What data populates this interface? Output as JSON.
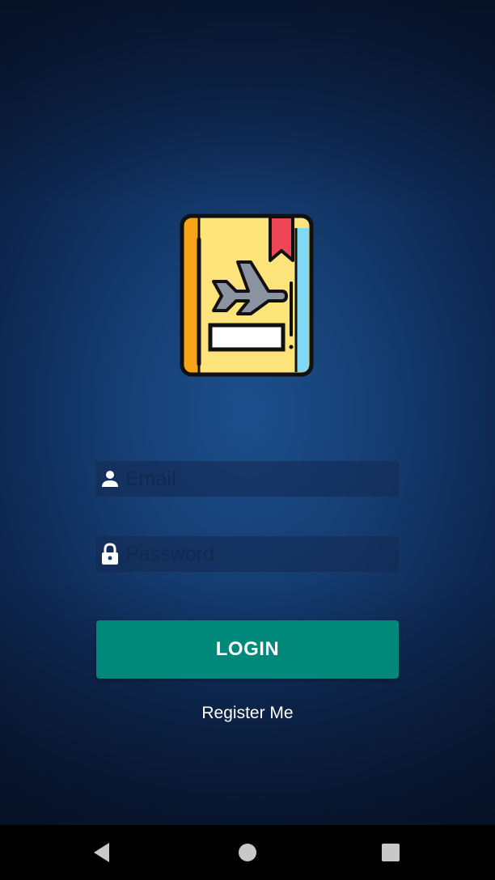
{
  "app": {
    "logo_icon": "travel-passport-icon"
  },
  "login_form": {
    "email_placeholder": "Email",
    "email_value": "",
    "email_icon": "person-icon",
    "password_placeholder": "Password",
    "password_value": "",
    "password_icon": "lock-icon",
    "login_label": "LOGIN",
    "register_label": "Register Me"
  },
  "colors": {
    "background_center": "#1d4f8c",
    "background_edge": "#0a1a37",
    "login_button": "#00897b",
    "nav_bar": "#000000"
  },
  "navigation_bar": {
    "back_icon": "back-triangle-icon",
    "home_icon": "home-circle-icon",
    "recents_icon": "recents-square-icon"
  }
}
